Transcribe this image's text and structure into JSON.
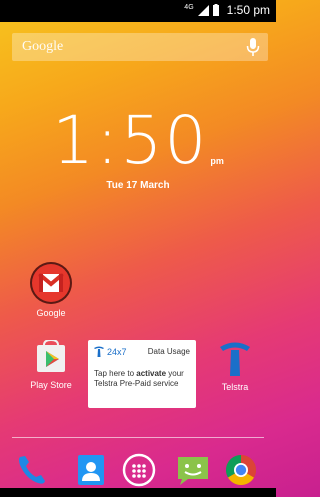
{
  "status_bar": {
    "network": "4G",
    "time": "1:50 pm"
  },
  "search": {
    "label": "Google"
  },
  "clock": {
    "time": "1:50",
    "ampm": "pm",
    "date": "Tue 17 March"
  },
  "apps": {
    "gmail": "Google",
    "play_store": "Play Store",
    "telstra": "Telstra"
  },
  "widget": {
    "brand": "24x7",
    "title": "Data Usage",
    "body_prefix": "Tap here to ",
    "body_bold": "activate",
    "body_suffix": " your Telstra Pre-Paid service"
  },
  "dock": {
    "icons": [
      "phone-icon",
      "contacts-icon",
      "app-drawer-icon",
      "messaging-icon",
      "chrome-icon"
    ]
  },
  "colors": {
    "telstra_blue": "#1a6fc9",
    "gmail_red": "#e6372c"
  }
}
